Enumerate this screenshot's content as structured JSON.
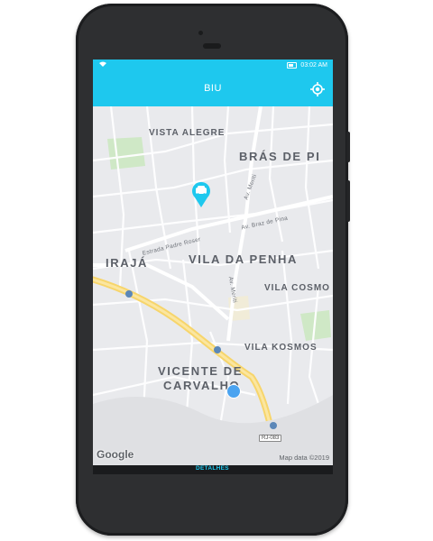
{
  "status_bar": {
    "time": "03:02 AM",
    "wifi_icon": "wifi-icon",
    "battery_icon": "battery-icon"
  },
  "app_bar": {
    "title": "BIU",
    "locate_icon": "gps-locate-icon",
    "background_color": "#1ec8ee"
  },
  "map": {
    "neighborhoods": [
      "VISTA ALEGRE",
      "BRÁS DE PI",
      "IRAJÁ",
      "VILA DA PENHA",
      "VILA COSMO",
      "VILA KOSMOS",
      "VICENTE DE",
      "CARVALHO"
    ],
    "streets": [
      "Estrada Padre Roser",
      "Av. Braz de Pina",
      "Av. Meriti",
      "Av. Meriti"
    ],
    "highway_shield": "RJ-083",
    "car_marker_icon": "car-marker-icon",
    "user_location_icon": "user-location-dot-icon",
    "attribution_logo": "Google",
    "attribution_text": "Map data ©2019"
  },
  "bottom_nav": {
    "active_tab": "DETALHES",
    "accent_color": "#1ec8ee"
  }
}
